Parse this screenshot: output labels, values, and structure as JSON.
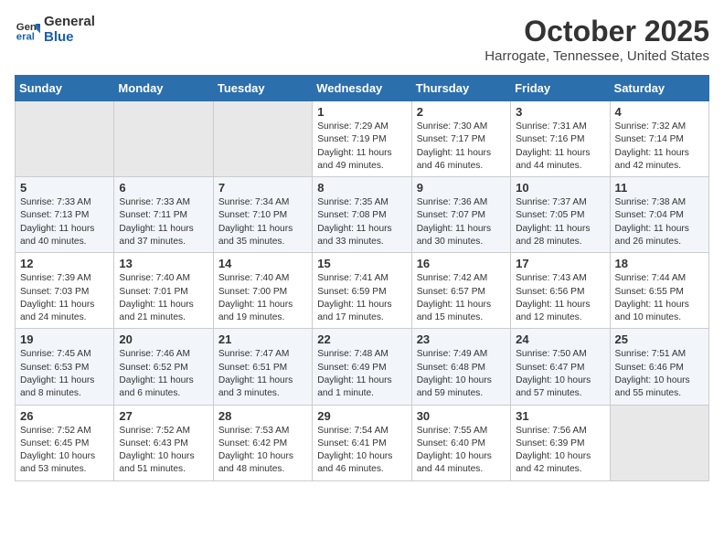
{
  "header": {
    "logo_line1": "General",
    "logo_line2": "Blue",
    "month": "October 2025",
    "location": "Harrogate, Tennessee, United States"
  },
  "weekdays": [
    "Sunday",
    "Monday",
    "Tuesday",
    "Wednesday",
    "Thursday",
    "Friday",
    "Saturday"
  ],
  "weeks": [
    [
      {
        "day": "",
        "info": ""
      },
      {
        "day": "",
        "info": ""
      },
      {
        "day": "",
        "info": ""
      },
      {
        "day": "1",
        "info": "Sunrise: 7:29 AM\nSunset: 7:19 PM\nDaylight: 11 hours\nand 49 minutes."
      },
      {
        "day": "2",
        "info": "Sunrise: 7:30 AM\nSunset: 7:17 PM\nDaylight: 11 hours\nand 46 minutes."
      },
      {
        "day": "3",
        "info": "Sunrise: 7:31 AM\nSunset: 7:16 PM\nDaylight: 11 hours\nand 44 minutes."
      },
      {
        "day": "4",
        "info": "Sunrise: 7:32 AM\nSunset: 7:14 PM\nDaylight: 11 hours\nand 42 minutes."
      }
    ],
    [
      {
        "day": "5",
        "info": "Sunrise: 7:33 AM\nSunset: 7:13 PM\nDaylight: 11 hours\nand 40 minutes."
      },
      {
        "day": "6",
        "info": "Sunrise: 7:33 AM\nSunset: 7:11 PM\nDaylight: 11 hours\nand 37 minutes."
      },
      {
        "day": "7",
        "info": "Sunrise: 7:34 AM\nSunset: 7:10 PM\nDaylight: 11 hours\nand 35 minutes."
      },
      {
        "day": "8",
        "info": "Sunrise: 7:35 AM\nSunset: 7:08 PM\nDaylight: 11 hours\nand 33 minutes."
      },
      {
        "day": "9",
        "info": "Sunrise: 7:36 AM\nSunset: 7:07 PM\nDaylight: 11 hours\nand 30 minutes."
      },
      {
        "day": "10",
        "info": "Sunrise: 7:37 AM\nSunset: 7:05 PM\nDaylight: 11 hours\nand 28 minutes."
      },
      {
        "day": "11",
        "info": "Sunrise: 7:38 AM\nSunset: 7:04 PM\nDaylight: 11 hours\nand 26 minutes."
      }
    ],
    [
      {
        "day": "12",
        "info": "Sunrise: 7:39 AM\nSunset: 7:03 PM\nDaylight: 11 hours\nand 24 minutes."
      },
      {
        "day": "13",
        "info": "Sunrise: 7:40 AM\nSunset: 7:01 PM\nDaylight: 11 hours\nand 21 minutes."
      },
      {
        "day": "14",
        "info": "Sunrise: 7:40 AM\nSunset: 7:00 PM\nDaylight: 11 hours\nand 19 minutes."
      },
      {
        "day": "15",
        "info": "Sunrise: 7:41 AM\nSunset: 6:59 PM\nDaylight: 11 hours\nand 17 minutes."
      },
      {
        "day": "16",
        "info": "Sunrise: 7:42 AM\nSunset: 6:57 PM\nDaylight: 11 hours\nand 15 minutes."
      },
      {
        "day": "17",
        "info": "Sunrise: 7:43 AM\nSunset: 6:56 PM\nDaylight: 11 hours\nand 12 minutes."
      },
      {
        "day": "18",
        "info": "Sunrise: 7:44 AM\nSunset: 6:55 PM\nDaylight: 11 hours\nand 10 minutes."
      }
    ],
    [
      {
        "day": "19",
        "info": "Sunrise: 7:45 AM\nSunset: 6:53 PM\nDaylight: 11 hours\nand 8 minutes."
      },
      {
        "day": "20",
        "info": "Sunrise: 7:46 AM\nSunset: 6:52 PM\nDaylight: 11 hours\nand 6 minutes."
      },
      {
        "day": "21",
        "info": "Sunrise: 7:47 AM\nSunset: 6:51 PM\nDaylight: 11 hours\nand 3 minutes."
      },
      {
        "day": "22",
        "info": "Sunrise: 7:48 AM\nSunset: 6:49 PM\nDaylight: 11 hours\nand 1 minute."
      },
      {
        "day": "23",
        "info": "Sunrise: 7:49 AM\nSunset: 6:48 PM\nDaylight: 10 hours\nand 59 minutes."
      },
      {
        "day": "24",
        "info": "Sunrise: 7:50 AM\nSunset: 6:47 PM\nDaylight: 10 hours\nand 57 minutes."
      },
      {
        "day": "25",
        "info": "Sunrise: 7:51 AM\nSunset: 6:46 PM\nDaylight: 10 hours\nand 55 minutes."
      }
    ],
    [
      {
        "day": "26",
        "info": "Sunrise: 7:52 AM\nSunset: 6:45 PM\nDaylight: 10 hours\nand 53 minutes."
      },
      {
        "day": "27",
        "info": "Sunrise: 7:52 AM\nSunset: 6:43 PM\nDaylight: 10 hours\nand 51 minutes."
      },
      {
        "day": "28",
        "info": "Sunrise: 7:53 AM\nSunset: 6:42 PM\nDaylight: 10 hours\nand 48 minutes."
      },
      {
        "day": "29",
        "info": "Sunrise: 7:54 AM\nSunset: 6:41 PM\nDaylight: 10 hours\nand 46 minutes."
      },
      {
        "day": "30",
        "info": "Sunrise: 7:55 AM\nSunset: 6:40 PM\nDaylight: 10 hours\nand 44 minutes."
      },
      {
        "day": "31",
        "info": "Sunrise: 7:56 AM\nSunset: 6:39 PM\nDaylight: 10 hours\nand 42 minutes."
      },
      {
        "day": "",
        "info": ""
      }
    ]
  ]
}
